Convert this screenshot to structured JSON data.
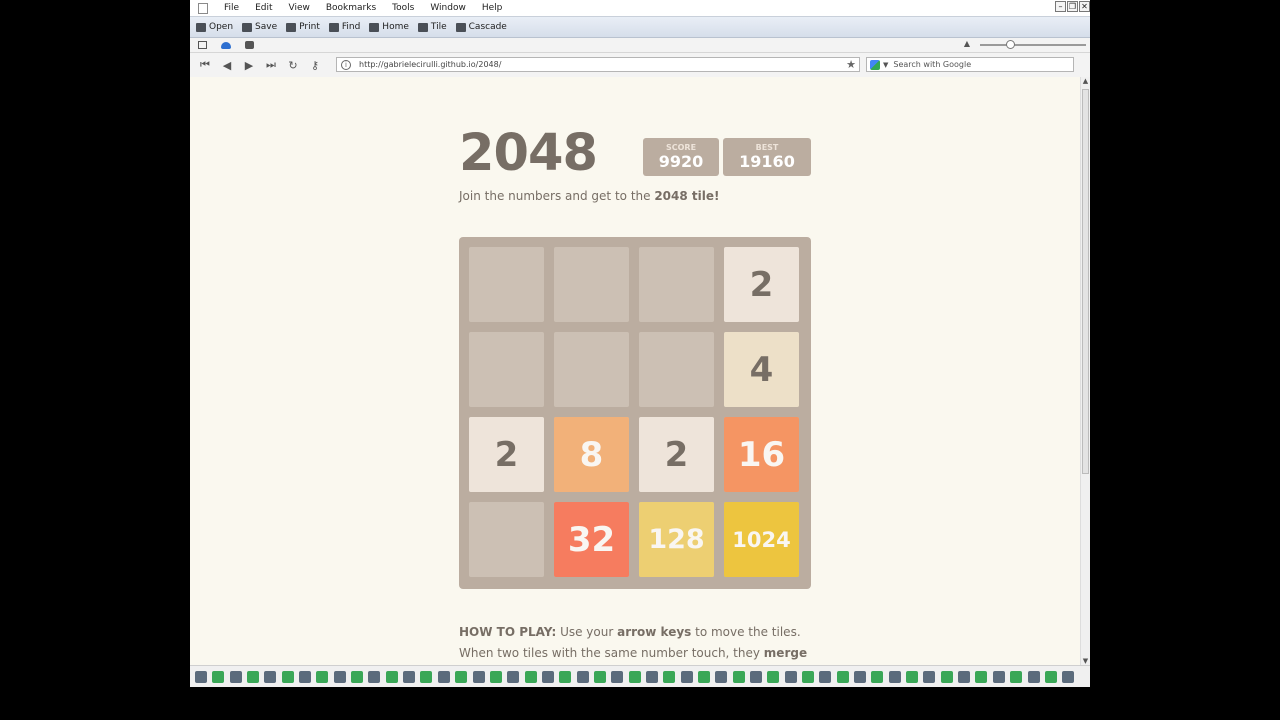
{
  "menu": {
    "items": [
      "File",
      "Edit",
      "View",
      "Bookmarks",
      "Tools",
      "Window",
      "Help"
    ]
  },
  "window_controls": {
    "minimize": "–",
    "restore": "❐",
    "close": "✕"
  },
  "toolbar": {
    "items": [
      {
        "label": "Open",
        "icon": "folder-icon"
      },
      {
        "label": "Save",
        "icon": "save-icon"
      },
      {
        "label": "Print",
        "icon": "print-icon"
      },
      {
        "label": "Find",
        "icon": "find-icon"
      },
      {
        "label": "Home",
        "icon": "home-icon"
      },
      {
        "label": "Tile",
        "icon": "tile-icon"
      },
      {
        "label": "Cascade",
        "icon": "cascade-icon"
      }
    ]
  },
  "nav": {
    "first": "⏮",
    "back": "◀",
    "forward": "▶",
    "fast_forward": "⏭",
    "reload": "↻",
    "key": "⚷"
  },
  "address": {
    "url": "http://gabrielecirulli.github.io/2048/",
    "star": "★"
  },
  "search": {
    "placeholder": "Search with Google"
  },
  "game": {
    "title": "2048",
    "score_label": "SCORE",
    "score_value": "9920",
    "best_label": "BEST",
    "best_value": "19160",
    "intro_prefix": "Join the numbers and get to the ",
    "intro_bold": "2048 tile!",
    "grid": [
      [
        0,
        0,
        0,
        2
      ],
      [
        0,
        0,
        0,
        4
      ],
      [
        2,
        8,
        2,
        16
      ],
      [
        0,
        32,
        128,
        1024
      ]
    ],
    "tile_colors": {
      "2": {
        "bg": "#eee4da",
        "fg": "#776e65",
        "size": 34
      },
      "4": {
        "bg": "#ede0c8",
        "fg": "#776e65",
        "size": 34
      },
      "8": {
        "bg": "#f2b179",
        "fg": "#f9f6f2",
        "size": 34
      },
      "16": {
        "bg": "#f59563",
        "fg": "#f9f6f2",
        "size": 34
      },
      "32": {
        "bg": "#f67c5f",
        "fg": "#f9f6f2",
        "size": 34
      },
      "128": {
        "bg": "#edcf72",
        "fg": "#f9f6f2",
        "size": 27
      },
      "1024": {
        "bg": "#edc53f",
        "fg": "#f9f6f2",
        "size": 21
      }
    }
  },
  "howto": {
    "label": "HOW TO PLAY:",
    "t1": " Use your ",
    "b1": "arrow keys",
    "t2": " to move the tiles. When two tiles with the same number touch, they ",
    "b2": "merge into one!"
  },
  "scrollbar": {
    "up": "▲",
    "down": "▼"
  }
}
